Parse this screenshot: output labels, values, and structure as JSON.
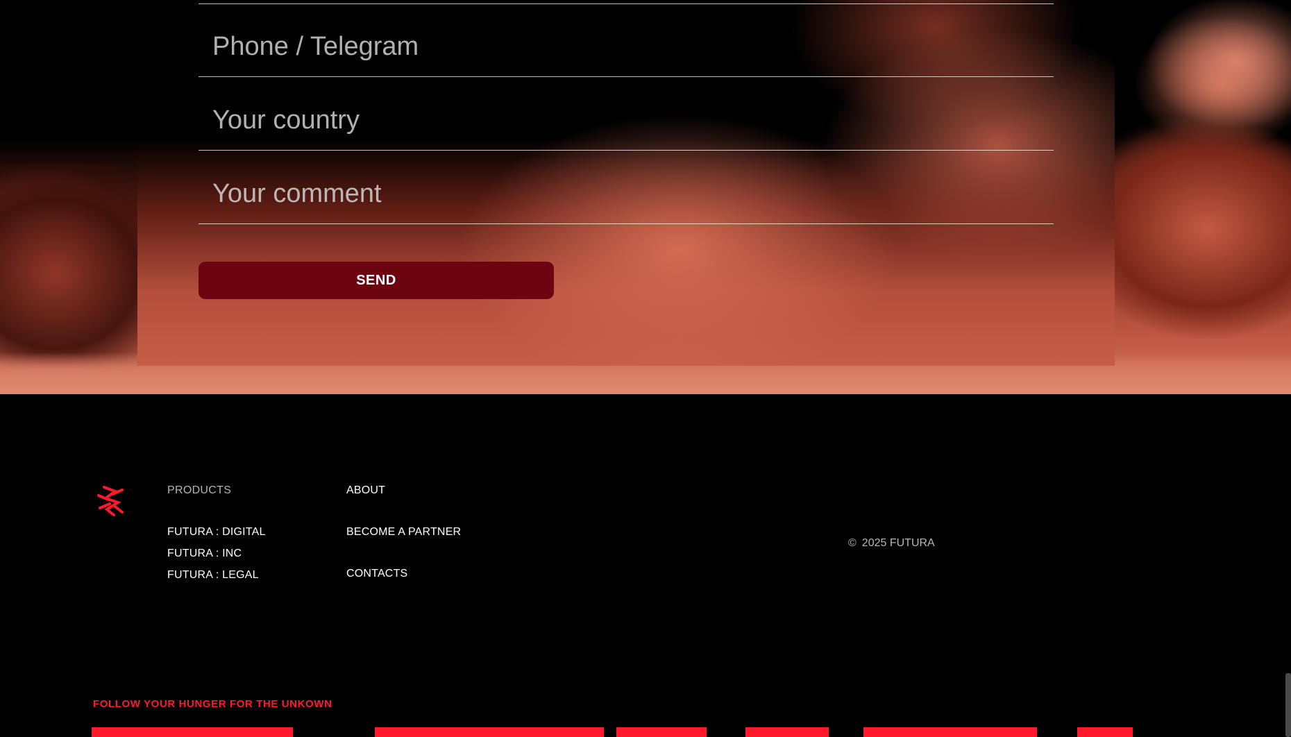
{
  "form": {
    "phone_placeholder": "Phone / Telegram",
    "country_placeholder": "Your country",
    "comment_placeholder": "Your comment",
    "send_label": "SEND",
    "send_color": "#6d0510"
  },
  "footer": {
    "logo_icon": "futura-logo-icon",
    "products": {
      "heading": "PRODUCTS",
      "items": [
        "FUTURA : DIGITAL",
        "FUTURA : INC",
        "FUTURA : LEGAL"
      ]
    },
    "company": {
      "items": [
        "ABOUT",
        "BECOME A PARTNER",
        "CONTACTS"
      ]
    },
    "copyright_symbol": "©",
    "copyright_text": "2025 FUTURA",
    "tagline": "FOLLOW YOUR HUNGER FOR THE UNKOWN",
    "accent_color": "#ff1a2b"
  }
}
